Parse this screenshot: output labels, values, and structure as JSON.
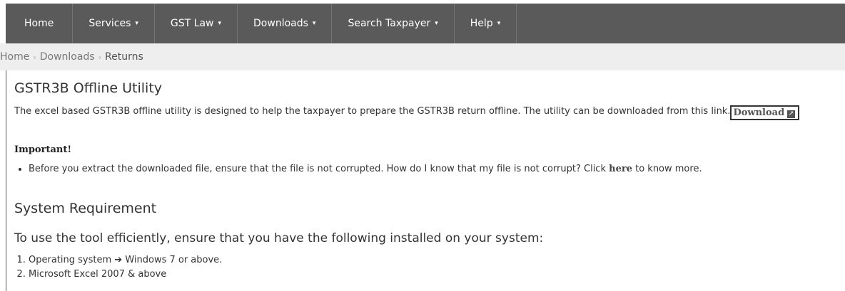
{
  "nav": {
    "items": [
      {
        "label": "Home",
        "caret": ""
      },
      {
        "label": "Services",
        "caret": "▾"
      },
      {
        "label": "GST Law",
        "caret": "▾"
      },
      {
        "label": "Downloads",
        "caret": "▾"
      },
      {
        "label": "Search Taxpayer",
        "caret": "▾"
      },
      {
        "label": "Help",
        "caret": "▾"
      }
    ]
  },
  "breadcrumb": {
    "home": "Home",
    "downloads": "Downloads",
    "current": "Returns",
    "separator": "›"
  },
  "section1": {
    "title": "GSTR3B Offline Utility",
    "desc": "The excel based GSTR3B offline utility is designed to help the taxpayer to prepare the GSTR3B return offline. The utility can be downloaded from this link.",
    "download_label": "Download",
    "important_label": "Important!",
    "bullet_text": "Before you extract the downloaded file, ensure that the file is not corrupted. How do I know that my file is not corrupt? Click ",
    "here_label": "here",
    "bullet_tail": " to know more."
  },
  "section2": {
    "title": "System Requirement",
    "intro": "To use the tool efficiently, ensure that you have the following installed on your system:",
    "req1_prefix": "Operating system",
    "req1_arrow": "➔",
    "req1_value": "Windows 7 or above.",
    "req2": "Microsoft Excel 2007 & above"
  }
}
